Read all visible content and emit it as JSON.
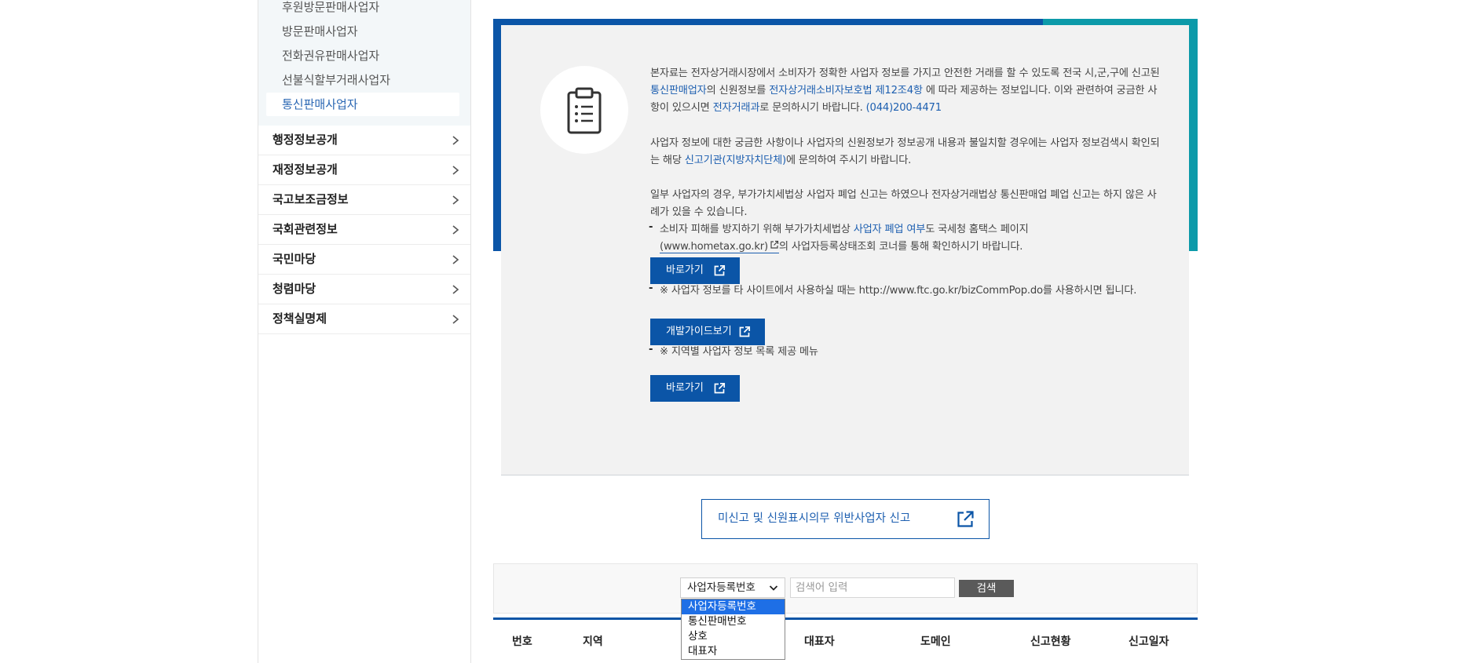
{
  "sidebar": {
    "submenu": [
      {
        "label": "후원방문판매사업자"
      },
      {
        "label": "방문판매사업자"
      },
      {
        "label": "전화권유판매사업자"
      },
      {
        "label": "선불식할부거래사업자"
      },
      {
        "label": "통신판매사업자",
        "active": true
      }
    ],
    "menu": [
      {
        "label": "행정정보공개"
      },
      {
        "label": "재정정보공개"
      },
      {
        "label": "국고보조금정보"
      },
      {
        "label": "국회관련정보"
      },
      {
        "label": "국민마당"
      },
      {
        "label": "청렴마당"
      },
      {
        "label": "정책실명제"
      }
    ]
  },
  "info": {
    "icon": "clipboard-icon",
    "p1_a": "본자료는 전자상거래시장에서 소비자가 정확한 사업자 정보를 가지고 안전한 거래를 할 수 있도록 전국 시,군,구에 신고된 ",
    "p1_link1": "통신판매업자",
    "p1_b": "의 신원정보를 ",
    "p1_link2": "전자상거래소비자보호법 제12조4항",
    "p1_c": " 에 따라 제공하는 정보입니다. 이와 관련하여 궁금한 사항이 있으시면 ",
    "p1_link3": "전자거래과",
    "p1_d": "로 문의하시기 바랍니다. ",
    "p1_phone": "(044)200-4471",
    "p2_a": "사업자 정보에 대한 궁금한 사항이나 사업자의 신원정보가 정보공개 내용과 불일치할 경우에는 사업자 정보검색시 확인되는 해당 ",
    "p2_link": "신고기관(지방자치단체)",
    "p2_b": "에 문의하여 주시기 바랍니다.",
    "p3": "일부 사업자의 경우, 부가가치세법상 사업자 폐업 신고는 하였으나 전자상거래법상 통신판매업 폐업 신고는 하지 않은 사례가 있을 수 있습니다.",
    "dash": "-",
    "b1_a": "소비자 피해를 방지하기 위해 부가가치세법상 ",
    "b1_link": "사업자 폐업 여부",
    "b1_b": "도 국세청 홈택스 페이지",
    "b1_url": "(www.hometax.go.kr)",
    "b1_c": "의 사업자등록상태조회 코너를 통해 확인하시기 바랍니다.",
    "btn1": "바로가기",
    "b2": "※ 사업자 정보를 타 사이트에서 사용하실 때는 http://www.ftc.go.kr/bizCommPop.do를 사용하시면 됩니다.",
    "btn2": "개발가이드보기",
    "b3": "※ 지역별 사업자 정보 목록 제공 메뉴",
    "btn3": "바로가기"
  },
  "report_button": "미신고 및 신원표시의무 위반사업자 신고",
  "search": {
    "select_value": "사업자등록번호",
    "options": [
      "사업자등록번호",
      "통신판매번호",
      "상호",
      "대표자"
    ],
    "placeholder": "검색어 입력",
    "button": "검색"
  },
  "table": {
    "headers": [
      "번호",
      "지역",
      "대표자",
      "도메인",
      "신고현황",
      "신고일자"
    ]
  },
  "colors": {
    "primary": "#0b55a7",
    "teal": "#0c9aa9",
    "link": "#1d5fb0",
    "select_highlight": "#1e6fe6"
  }
}
